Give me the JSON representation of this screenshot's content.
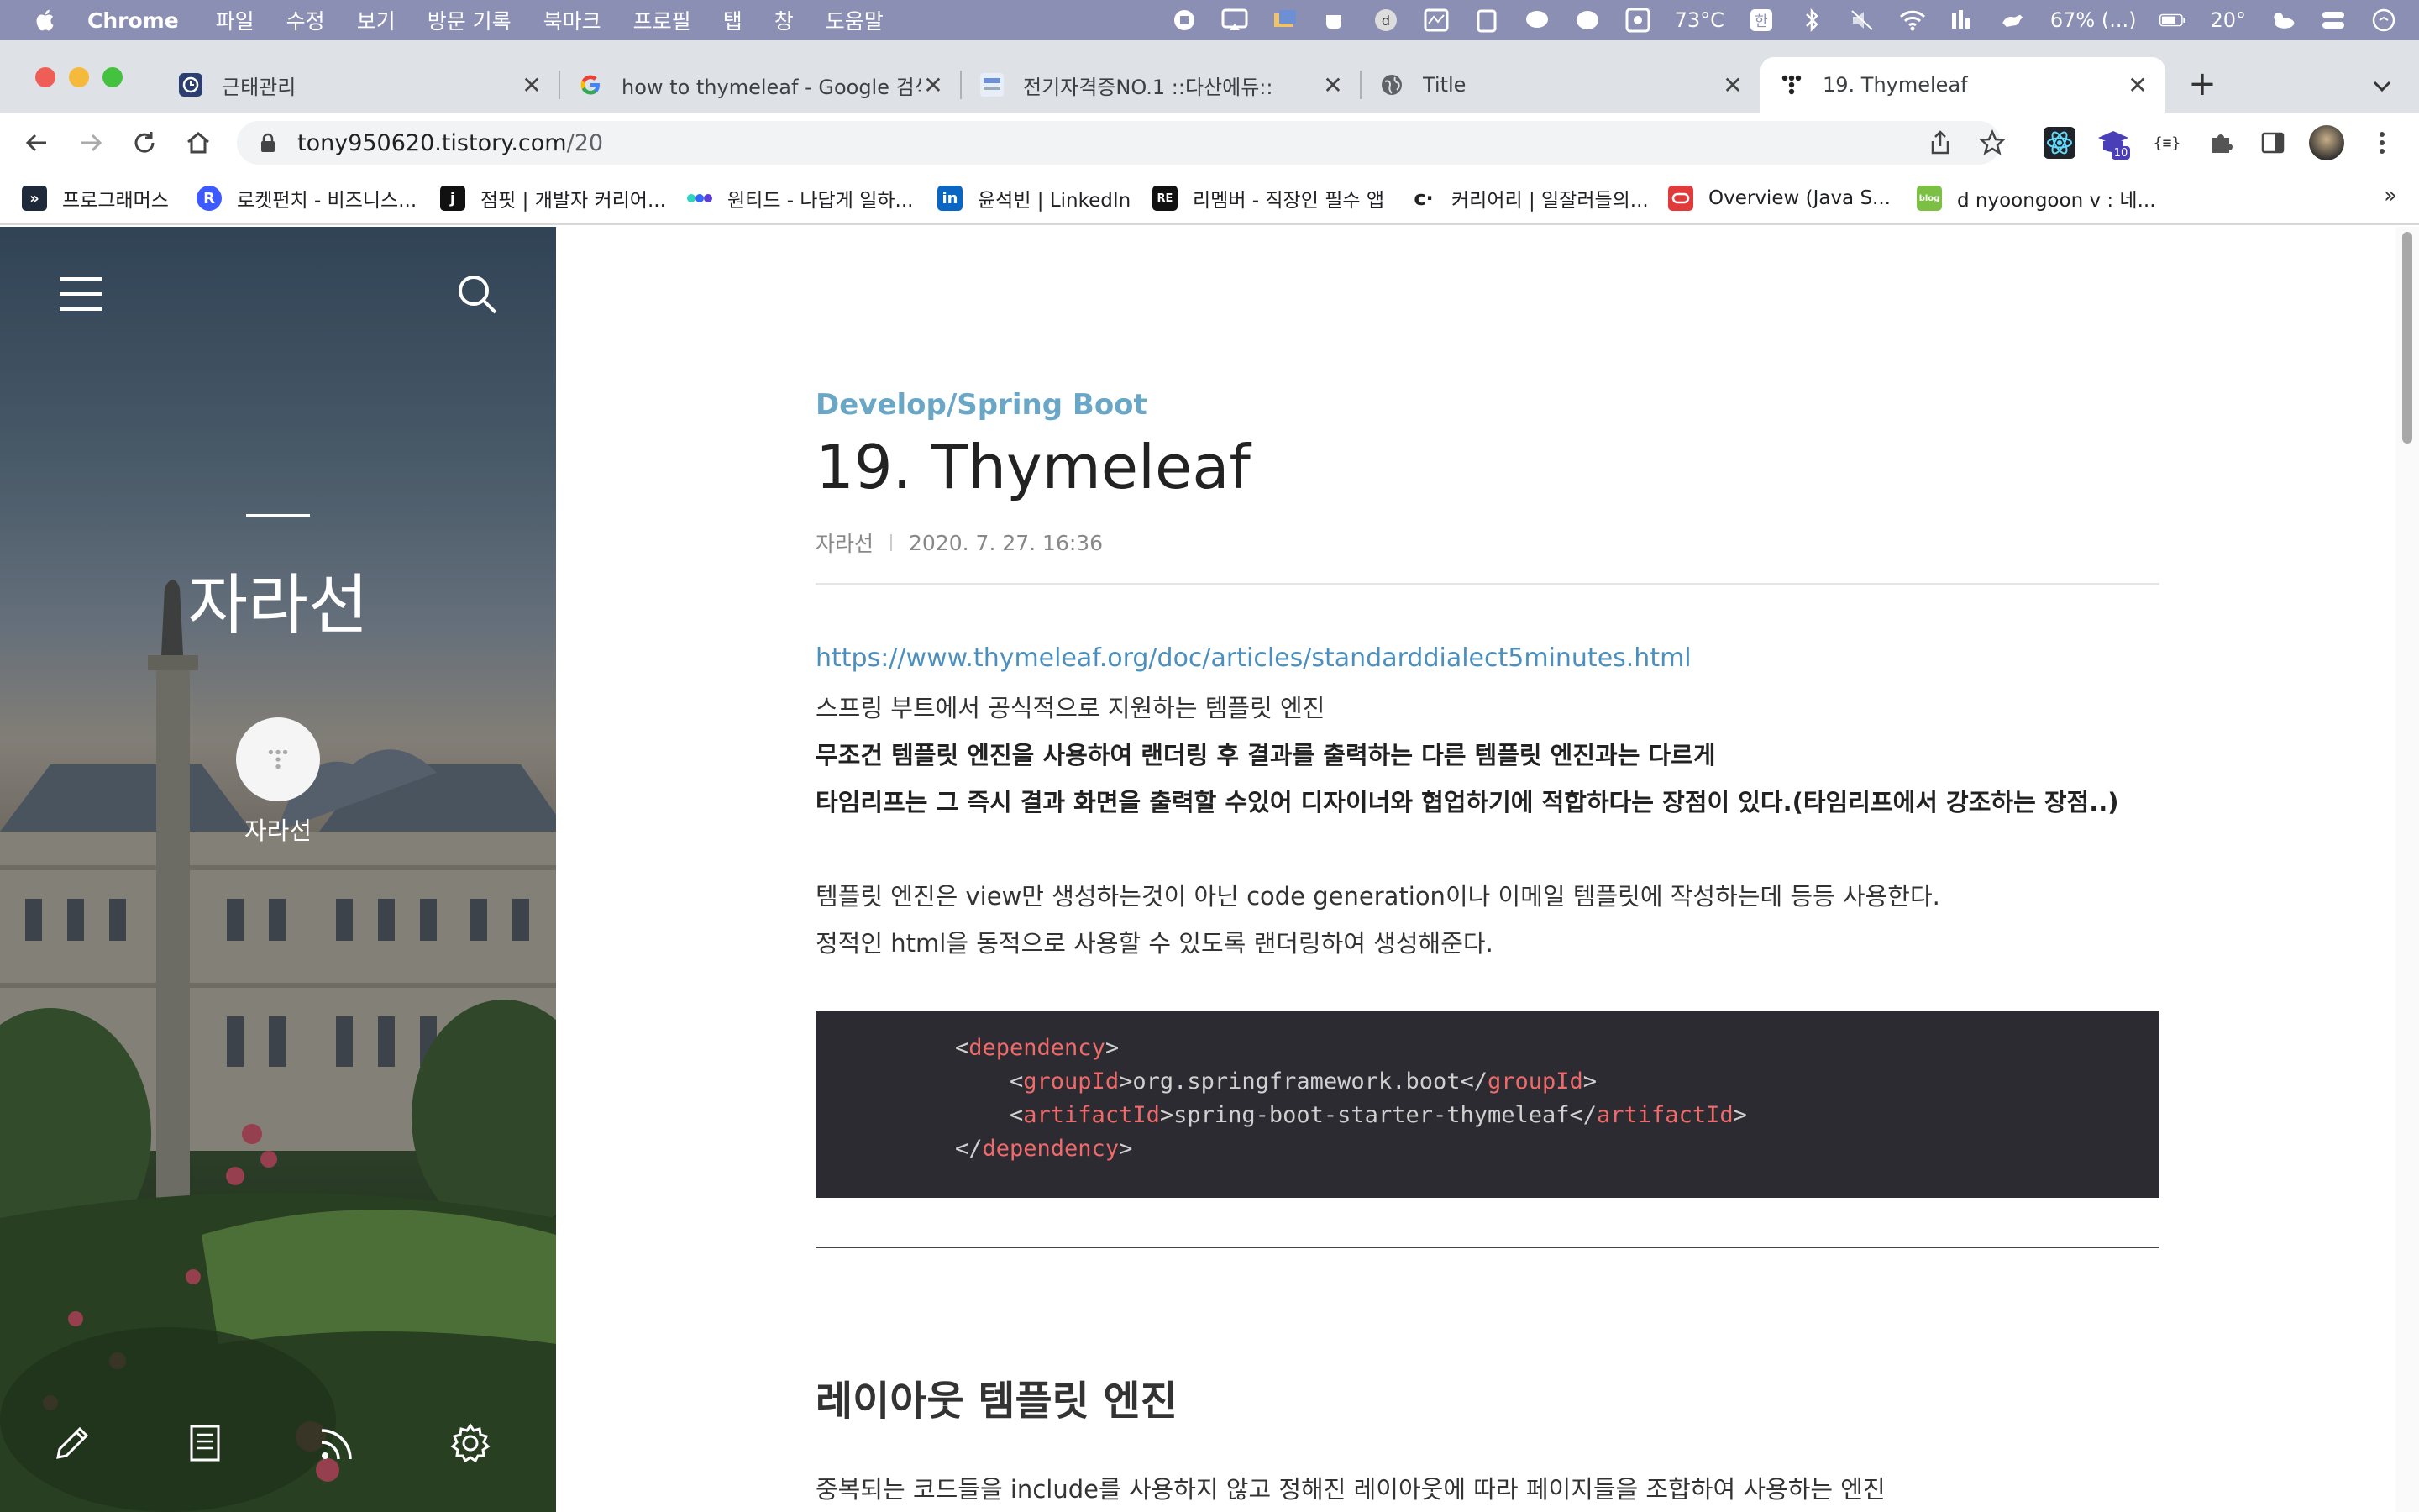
{
  "menubar": {
    "app_name": "Chrome",
    "menus": [
      "파일",
      "수정",
      "보기",
      "방문 기록",
      "북마크",
      "프로필",
      "탭",
      "창",
      "도움말"
    ],
    "weather": "73°C",
    "ime": "한",
    "battery": "67% (...)",
    "temperature": "20°"
  },
  "tabs": [
    {
      "title": "근태관리",
      "icon": "clock-icon",
      "active": false
    },
    {
      "title": "how to thymeleaf - Google 검색",
      "icon": "google-icon",
      "active": false
    },
    {
      "title": "전기자격증NO.1 ::다산에듀::",
      "icon": "dasan-icon",
      "active": false
    },
    {
      "title": "Title",
      "icon": "globe-icon",
      "active": false
    },
    {
      "title": "19. Thymeleaf",
      "icon": "tistory-icon",
      "active": true
    }
  ],
  "toolbar": {
    "url_host": "tony950620.tistory.com",
    "url_path": "/20",
    "extension_badge": "10"
  },
  "bookmarks": [
    {
      "label": "프로그래머스",
      "icon": "programmers-icon",
      "color": "#1e2a3a"
    },
    {
      "label": "로켓펀치 - 비즈니스...",
      "icon": "rocketpunch-icon",
      "color": "#3d5afe"
    },
    {
      "label": "점핏 | 개발자 커리어...",
      "icon": "jumpit-icon",
      "color": "#111111"
    },
    {
      "label": "원티드 - 나답게 일하...",
      "icon": "wanted-icon",
      "color": "#3366ff"
    },
    {
      "label": "윤석빈 | LinkedIn",
      "icon": "linkedin-icon",
      "color": "#0a66c2"
    },
    {
      "label": "리멤버 - 직장인 필수 앱",
      "icon": "remember-icon",
      "color": "#111111"
    },
    {
      "label": "커리어리 | 일잘러들의...",
      "icon": "careerly-icon",
      "color": "#222222"
    },
    {
      "label": "Overview (Java S...",
      "icon": "oracle-icon",
      "color": "#e03a3a"
    },
    {
      "label": "d nyoongoon v : 네...",
      "icon": "blog-icon",
      "color": "#7bc043"
    }
  ],
  "sidebar": {
    "blog_title": "자라선",
    "profile_name": "자라선"
  },
  "article": {
    "category": "Develop/Spring Boot",
    "title": "19. Thymeleaf",
    "author": "자라선",
    "date": "2020. 7. 27. 16:36",
    "link": "https://www.thymeleaf.org/doc/articles/standarddialect5minutes.html",
    "p1": "스프링 부트에서 공식적으로 지원하는 템플릿 엔진",
    "p2": "무조건 템플릿 엔진을 사용하여 랜더링 후 결과를 출력하는 다른 템플릿 엔진과는 다르게",
    "p3": "타임리프는 그 즉시 결과 화면을 출력할 수있어 디자이너와 협업하기에 적합하다는 장점이 있다.(타임리프에서 강조하는 장점..)",
    "p4": "템플릿 엔진은 view만 생성하는것이 아닌 code generation이나 이메일 템플릿에 작성하는데 등등 사용한다.",
    "p5": "정적인 html을 동적으로 사용할 수 있도록 랜더링하여 생성해준다.",
    "code": {
      "line1_tag": "dependency",
      "line2_tag": "groupId",
      "line2_value": "org.springframework.boot",
      "line3_tag": "artifactId",
      "line3_value": "spring-boot-starter-thymeleaf",
      "line4_tag": "dependency"
    },
    "section_heading": "레이아웃 템플릿 엔진",
    "section_para": "중복되는 코드들을 include를 사용하지 않고 정해진 레이아웃에 따라 페이지들을 조합하여 사용하는 엔진"
  },
  "colors": {
    "menubar_bg": "#8b8fb3",
    "category": "#6aa6c6",
    "link": "#4b8fbf",
    "code_bg": "#2b2b31",
    "code_tag": "#ef6a6a"
  }
}
